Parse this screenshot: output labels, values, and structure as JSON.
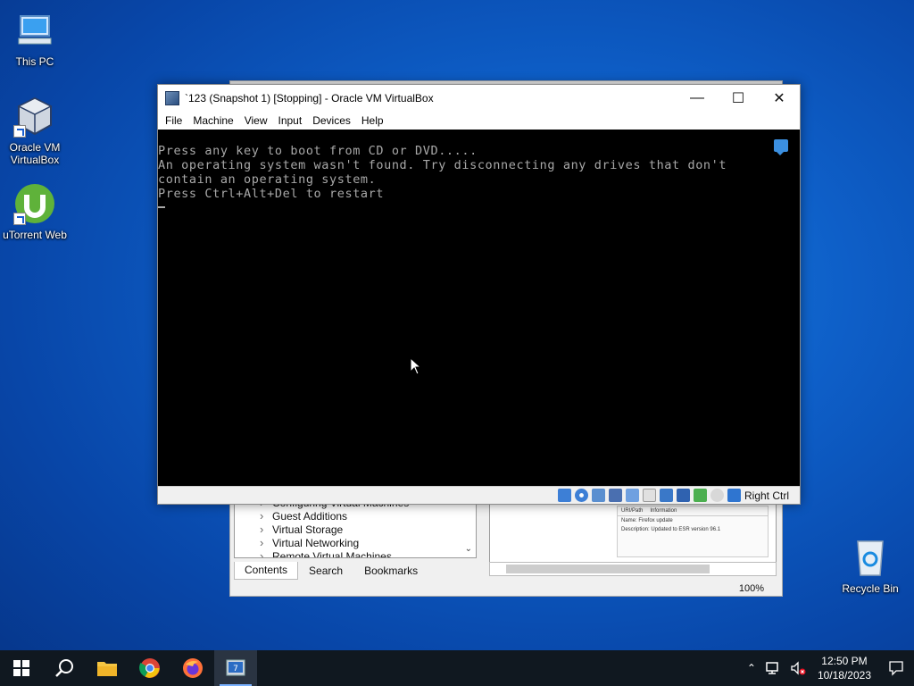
{
  "desktop": {
    "icons": [
      {
        "label": "This PC",
        "icon": "this-pc-icon"
      },
      {
        "label": "Oracle VM\nVirtualBox",
        "icon": "virtualbox-icon"
      },
      {
        "label": "uTorrent Web",
        "icon": "utorrent-icon"
      },
      {
        "label": "Recycle Bin",
        "icon": "recycle-bin-icon"
      }
    ]
  },
  "help_window": {
    "tree_items": [
      "Configuring Virtual Machines",
      "Guest Additions",
      "Virtual Storage",
      "Virtual Networking",
      "Remote Virtual Machines"
    ],
    "tabs": [
      "Contents",
      "Search",
      "Bookmarks"
    ],
    "active_tab": "Contents",
    "zoom": "100%",
    "pane": {
      "tab1": "URI/Path",
      "tab2": "Information",
      "name_label": "Name:",
      "name_value": "Firefox update",
      "desc_label": "Description:",
      "desc_value": "Updated to ESR version 96.1"
    }
  },
  "vbox": {
    "title": "`123 (Snapshot 1) [Stopping] - Oracle VM VirtualBox",
    "menu": [
      "File",
      "Machine",
      "View",
      "Input",
      "Devices",
      "Help"
    ],
    "screen_lines": [
      "Press any key to boot from CD or DVD.....",
      "An operating system wasn't found. Try disconnecting any drives that don't",
      "contain an operating system.",
      "Press Ctrl+Alt+Del to restart"
    ],
    "host_key": "Right Ctrl",
    "status_icons": [
      "hard-disk-icon",
      "optical-drive-icon",
      "audio-icon",
      "network-icon",
      "usb-icon",
      "shared-folders-icon",
      "display-icon",
      "recording-icon",
      "cpu-icon",
      "mouse-integration-icon",
      "keyboard-icon"
    ]
  },
  "taskbar": {
    "apps": [
      "start-icon",
      "search-icon",
      "file-explorer-icon",
      "chrome-icon",
      "firefox-icon",
      "virtualbox-taskbar-icon"
    ],
    "time": "12:50 PM",
    "date": "10/18/2023"
  }
}
